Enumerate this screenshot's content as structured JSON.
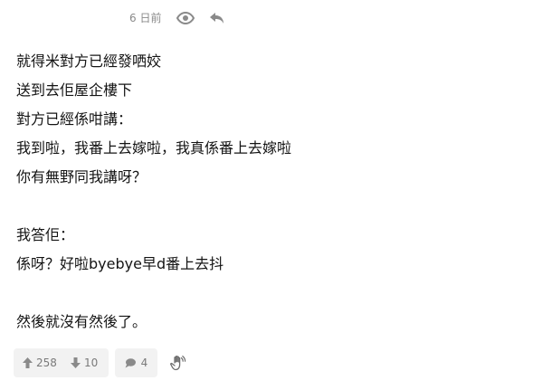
{
  "post": {
    "time": "6 日前",
    "lines": [
      "就得米對方已經發哂姣",
      "送到去佢屋企樓下",
      "對方已經係咁講：",
      "我到啦，我番上去嫁啦，我真係番上去嫁啦",
      "你有無野同我講呀？",
      "",
      "我答佢：",
      "係呀？好啦byebye早d番上去抖",
      "",
      "然後就沒有然後了。"
    ]
  },
  "actions": {
    "upvotes": "258",
    "downvotes": "10",
    "comments": "4"
  },
  "icons": {
    "view": "eye-icon",
    "reply": "reply-icon",
    "upvote": "arrow-up-icon",
    "downvote": "arrow-down-icon",
    "comment": "comment-bubble-icon",
    "report": "hand-icon"
  },
  "colors": {
    "icon_gray": "#8a8a8a",
    "box_bg": "#f2f2f2",
    "text": "#141414",
    "muted_text": "#7a7a7a"
  }
}
